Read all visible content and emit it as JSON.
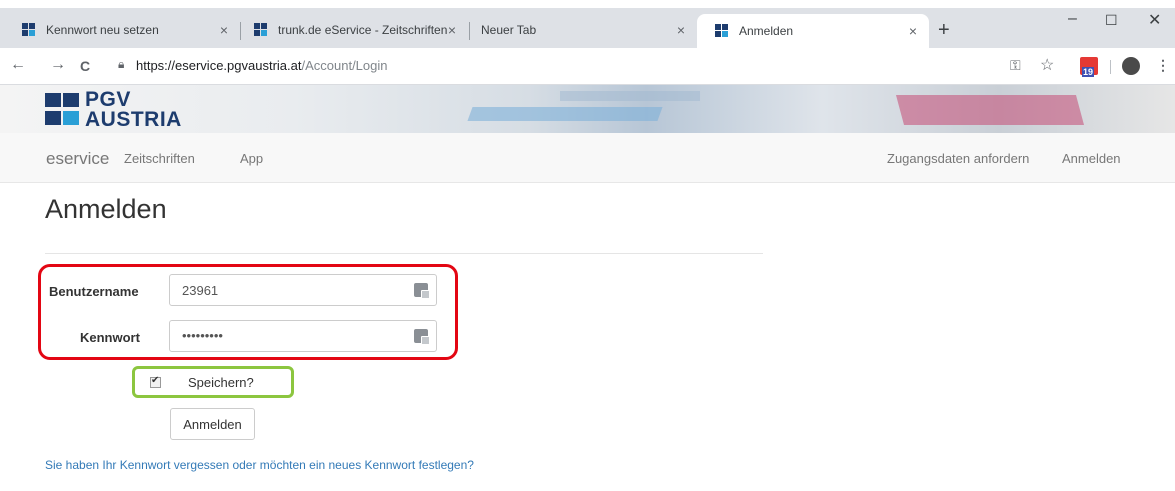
{
  "browser": {
    "tabs": [
      {
        "title": "Kennwort neu setzen",
        "close": "×",
        "active": false
      },
      {
        "title": "trunk.de eService - Zeitschriften",
        "close": "×",
        "active": false
      },
      {
        "title": "Neuer Tab",
        "close": "×",
        "active": false
      },
      {
        "title": "Anmelden",
        "close": "×",
        "active": true
      }
    ],
    "new_tab": "+",
    "window_controls": {
      "minimize": "–",
      "maximize": "☐",
      "close": "✕"
    },
    "nav": {
      "back": "←",
      "forward": "→",
      "reload": "C"
    },
    "url_host": "https://eservice.pgvaustria.at",
    "url_path": "/Account/Login",
    "toolbar_icons": {
      "key": "⚿",
      "star": "☆",
      "menu": "⋮"
    },
    "calendar_badge": "19"
  },
  "site": {
    "logo_line1": "PGV",
    "logo_line2": "AUSTRIA",
    "brand": "eservice",
    "nav_left": [
      "Zeitschriften",
      "App"
    ],
    "nav_right": [
      "Zugangsdaten anfordern",
      "Anmelden"
    ]
  },
  "form": {
    "title": "Anmelden",
    "username_label": "Benutzername",
    "username_value": "23961",
    "password_label": "Kennwort",
    "password_value": "•••••••••",
    "remember_label": "Speichern?",
    "remember_checked": true,
    "submit_label": "Anmelden",
    "forgot_link": "Sie haben Ihr Kennwort vergessen oder möchten ein neues Kennwort festlegen?"
  },
  "colors": {
    "highlight_red": "#e30613",
    "highlight_green": "#8cc63f",
    "link": "#337ab7",
    "logo_blue": "#1d3c6e",
    "logo_teal": "#2a9fd6"
  }
}
